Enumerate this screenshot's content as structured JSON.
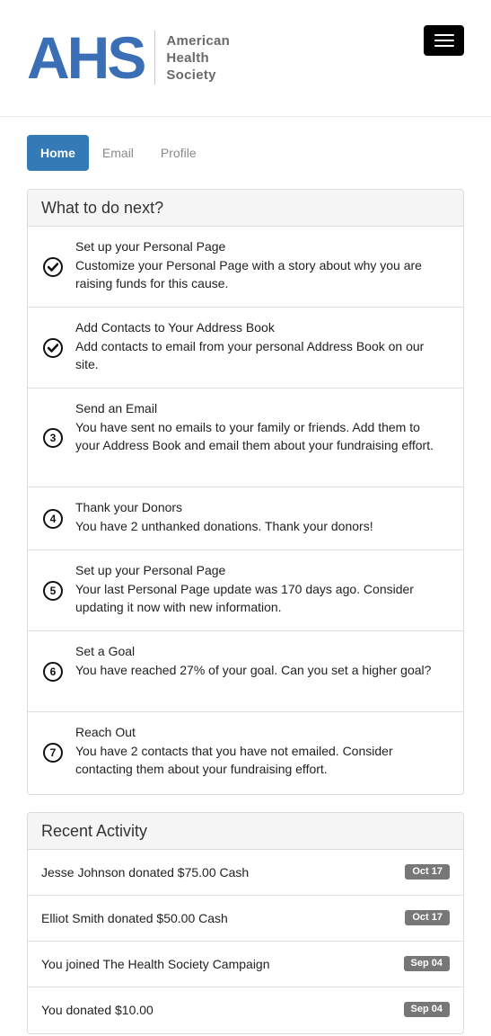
{
  "brand": {
    "mark": "AHS",
    "name_lines": [
      "American",
      "Health",
      "Society"
    ]
  },
  "nav": {
    "menu_icon": "hamburger-menu-icon",
    "tabs": [
      {
        "label": "Home",
        "active": true
      },
      {
        "label": "Email",
        "active": false
      },
      {
        "label": "Profile",
        "active": false
      }
    ]
  },
  "todo": {
    "heading": "What to do next?",
    "items": [
      {
        "status": "done",
        "icon": "check-circle-icon",
        "title": "Set up your Personal Page",
        "desc": "Customize your Personal Page with a story about why you are raising funds for this cause."
      },
      {
        "status": "done",
        "icon": "check-circle-icon",
        "title": "Add Contacts to Your Address Book",
        "desc": "Add contacts to email from your personal Address Book on our site."
      },
      {
        "status": "pending",
        "number": "3",
        "title": "Send an Email",
        "desc": "You have sent no emails to your family or friends. Add them to your Address Book and email them about your fundraising effort."
      },
      {
        "status": "pending",
        "number": "4",
        "title": "Thank your Donors",
        "desc": "You have 2 unthanked donations. Thank your donors!"
      },
      {
        "status": "pending",
        "number": "5",
        "title": "Set up your Personal Page",
        "desc": "Your last Personal Page update was 170 days ago. Consider updating it now with new information."
      },
      {
        "status": "pending",
        "number": "6",
        "title": "Set a Goal",
        "desc": "You have reached 27% of your goal. Can you set a higher goal?"
      },
      {
        "status": "pending",
        "number": "7",
        "title": "Reach Out",
        "desc": "You have 2 contacts that you have not emailed. Consider contacting them about your fundraising effort."
      }
    ]
  },
  "activity": {
    "heading": "Recent Activity",
    "items": [
      {
        "text": "Jesse Johnson donated $75.00 Cash",
        "date": "Oct 17"
      },
      {
        "text": "Elliot Smith donated $50.00 Cash",
        "date": "Oct 17"
      },
      {
        "text": "You joined The Health Society Campaign",
        "date": "Sep 04"
      },
      {
        "text": "You donated $10.00",
        "date": "Sep 04"
      }
    ]
  },
  "colors": {
    "brand_blue": "#3a6fb5",
    "tab_active": "#337ab7",
    "badge": "#777777"
  }
}
